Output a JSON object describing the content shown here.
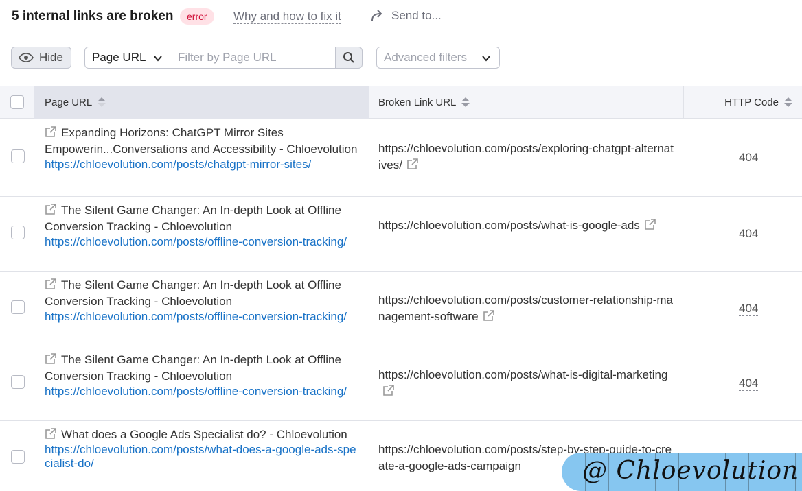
{
  "header": {
    "title": "5 internal links are broken",
    "badge": "error",
    "why_link": "Why and how to fix it",
    "send_label": "Send to..."
  },
  "toolbar": {
    "hide_label": "Hide",
    "select_value": "Page URL",
    "filter_placeholder": "Filter by Page URL",
    "advanced_label": "Advanced filters"
  },
  "table": {
    "columns": [
      "Page URL",
      "Broken Link URL",
      "HTTP Code"
    ],
    "rows": [
      {
        "title": "Expanding Horizons: ChatGPT Mirror Sites Empowerin...Conversations and Accessibility - Chloevolution",
        "url": "https://chloevolution.com/posts/chatgpt-mirror-sites/",
        "broken": "https://chloevolution.com/posts/exploring-chatgpt-alternatives/",
        "code": "404"
      },
      {
        "title": "The Silent Game Changer: An In-depth Look at Offline Conversion Tracking - Chloevolution",
        "url": "https://chloevolution.com/posts/offline-conversion-tracking/",
        "broken": "https://chloevolution.com/posts/what-is-google-ads",
        "code": "404"
      },
      {
        "title": "The Silent Game Changer: An In-depth Look at Offline Conversion Tracking - Chloevolution",
        "url": "https://chloevolution.com/posts/offline-conversion-tracking/",
        "broken": "https://chloevolution.com/posts/customer-relationship-management-software",
        "code": "404"
      },
      {
        "title": "The Silent Game Changer: An In-depth Look at Offline Conversion Tracking - Chloevolution",
        "url": "https://chloevolution.com/posts/offline-conversion-tracking/",
        "broken": "https://chloevolution.com/posts/what-is-digital-marketing",
        "code": "404"
      },
      {
        "title": "What does a Google Ads Specialist do? - Chloevolution",
        "url": "https://chloevolution.com/posts/what-does-a-google-ads-specialist-do/",
        "broken": "https://chloevolution.com/posts/step-by-step-guide-to-create-a-google-ads-campaign",
        "code": ""
      }
    ]
  },
  "watermark": "@ Chloevolution",
  "colors": {
    "link": "#1a73c7",
    "badge_bg": "#ffe1e6",
    "badge_text": "#d1123b",
    "header_bg": "#f4f5f9",
    "active_col_bg": "#e2e4ec",
    "watermark_bg": "#86c6f0"
  }
}
